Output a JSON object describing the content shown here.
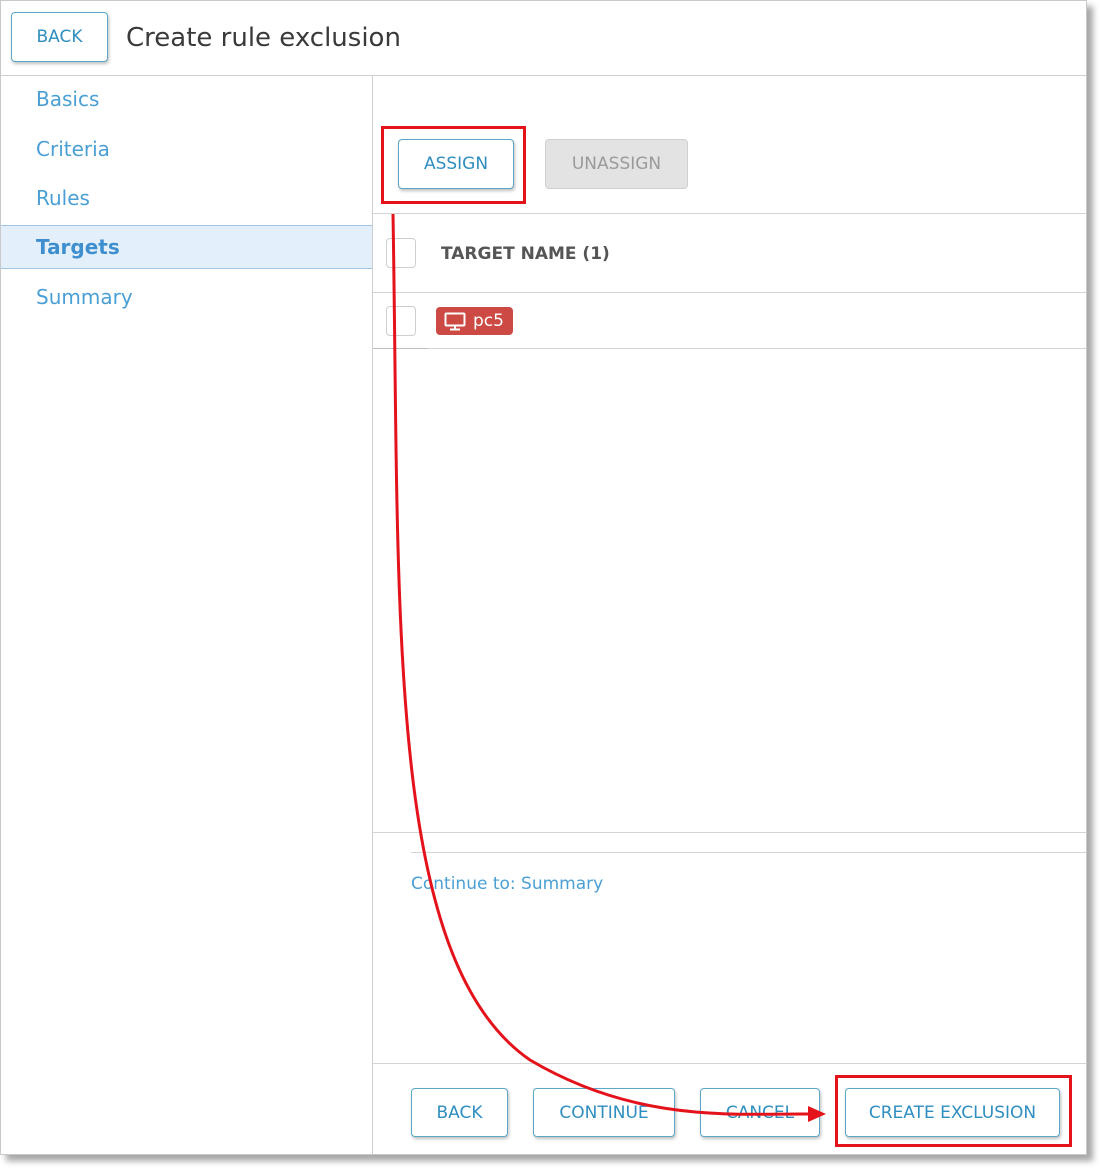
{
  "header": {
    "back_label": "BACK",
    "title": "Create rule exclusion"
  },
  "sidebar": {
    "items": [
      {
        "label": "Basics",
        "active": false
      },
      {
        "label": "Criteria",
        "active": false
      },
      {
        "label": "Rules",
        "active": false
      },
      {
        "label": "Targets",
        "active": true
      },
      {
        "label": "Summary",
        "active": false
      }
    ]
  },
  "toolbar": {
    "assign_label": "ASSIGN",
    "unassign_label": "UNASSIGN"
  },
  "table": {
    "column_header": "TARGET NAME (1)",
    "rows": [
      {
        "name": "pc5",
        "icon": "monitor-icon"
      }
    ]
  },
  "continue_link": "Continue to: Summary",
  "footer": {
    "back_label": "BACK",
    "continue_label": "CONTINUE",
    "cancel_label": "CANCEL",
    "create_label": "CREATE EXCLUSION"
  },
  "colors": {
    "accent": "#4a9fd4",
    "target_tag": "#cc4a43",
    "annotation": "#e4131b"
  }
}
